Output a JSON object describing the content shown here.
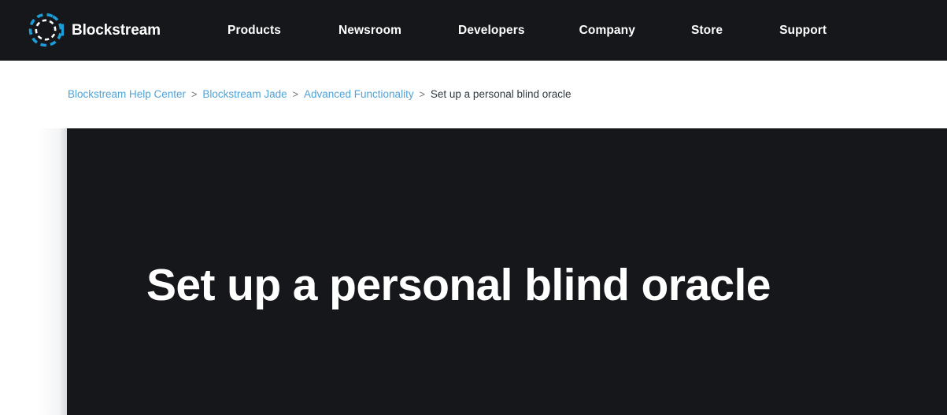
{
  "header": {
    "brand": {
      "name": "Blockstream",
      "logo_icon": "blockstream-dashed-circle-icon",
      "outer_ring_color": "#1b9ed8",
      "inner_ring_color": "#ffffff"
    },
    "background_color": "#15171b",
    "nav_items": [
      {
        "label": "Products"
      },
      {
        "label": "Newsroom"
      },
      {
        "label": "Developers"
      },
      {
        "label": "Company"
      },
      {
        "label": "Store"
      },
      {
        "label": "Support"
      }
    ]
  },
  "breadcrumb": {
    "separator": ">",
    "link_color": "#4fa3d9",
    "current_color": "#2f3941",
    "items": [
      {
        "label": "Blockstream Help Center",
        "current": false
      },
      {
        "label": "Blockstream Jade",
        "current": false
      },
      {
        "label": "Advanced Functionality",
        "current": false
      },
      {
        "label": "Set up a personal blind oracle",
        "current": true
      }
    ]
  },
  "hero": {
    "title": "Set up a personal blind oracle",
    "background_color": "#15171b",
    "text_color": "#ffffff"
  }
}
